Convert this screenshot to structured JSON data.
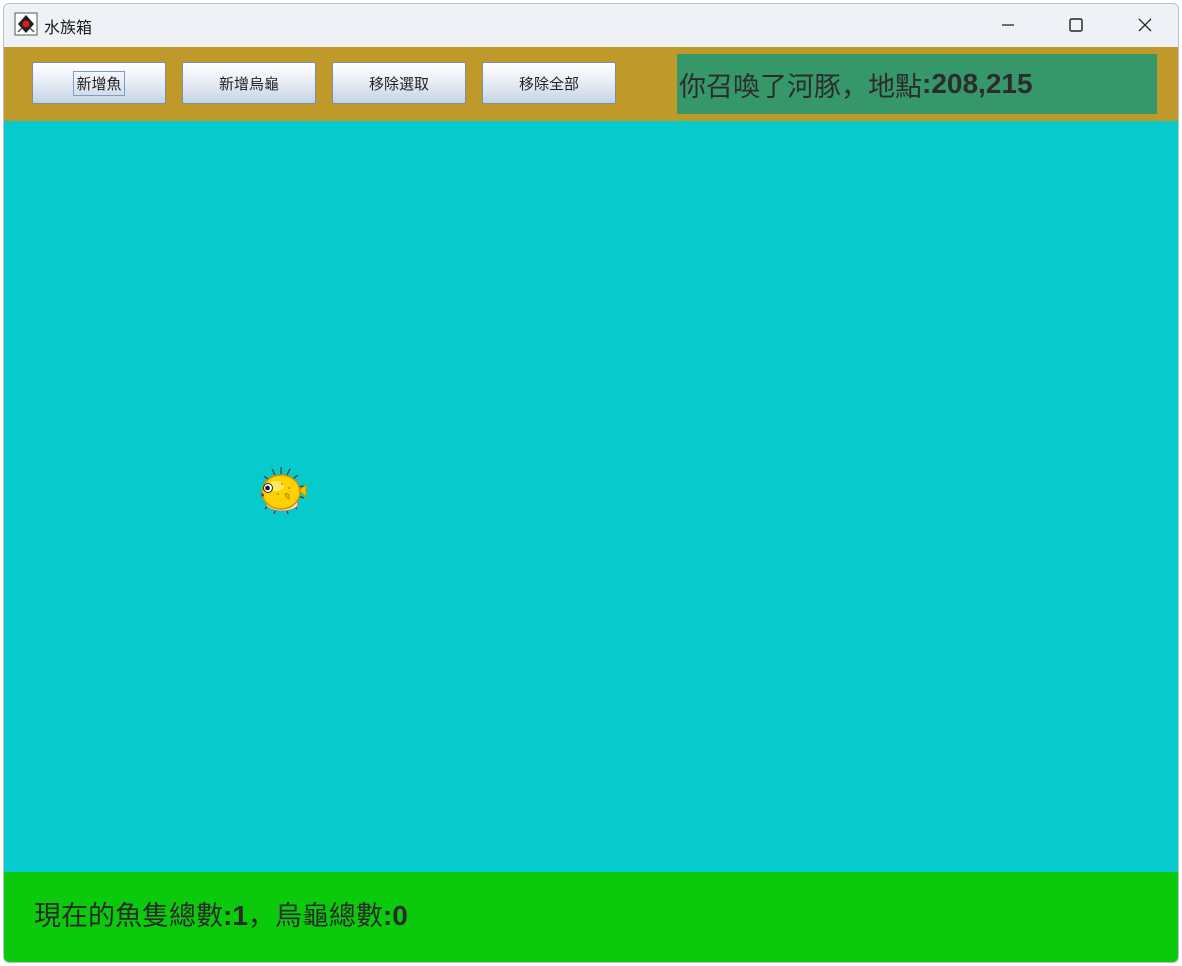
{
  "window": {
    "title": "水族箱"
  },
  "toolbar": {
    "add_fish_label": "新增魚",
    "add_turtle_label": "新增烏龜",
    "remove_selected_label": "移除選取",
    "remove_all_label": "移除全部"
  },
  "message": {
    "prefix": "你召喚了河豚，地點",
    "coords": ":208,215"
  },
  "status": {
    "fish_prefix": "現在的魚隻總數",
    "fish_count": ":1",
    "turtle_prefix": "，烏龜總數",
    "turtle_count": ":0"
  },
  "colors": {
    "toolbar_bg": "#bf9a2b",
    "message_bg": "#35976a",
    "tank_bg": "#06cacb",
    "status_bg": "#0bca0b"
  },
  "icons": {
    "app": "java-duke-icon",
    "creature": "pufferfish"
  }
}
